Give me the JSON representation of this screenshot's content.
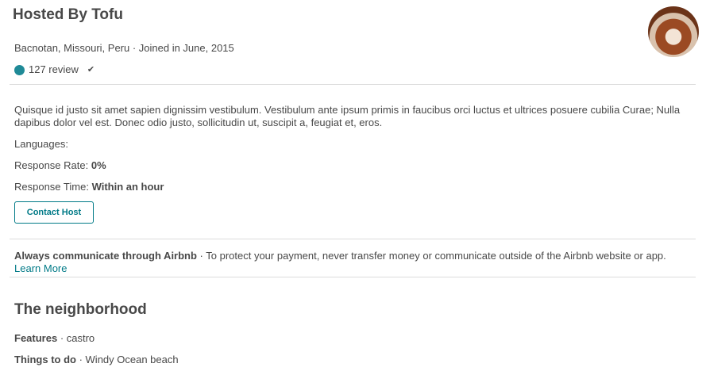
{
  "host": {
    "title": "Hosted By Tofu",
    "location": "Bacnotan, Missouri, Peru · Joined in June, 2015",
    "reviews": "127 review",
    "bio": "Quisque id justo sit amet sapien dignissim vestibulum. Vestibulum ante ipsum primis in faucibus orci luctus et ultrices posuere cubilia Curae; Nulla dapibus dolor vel est. Donec odio justo, sollicitudin ut, suscipit a, feugiat et, eros.",
    "languages_label": "Languages:",
    "response_rate_label": "Response Rate:",
    "response_rate": "0%",
    "response_time_label": "Response Time:",
    "response_time": "Within an hour",
    "contact_button": "Contact Host"
  },
  "notice": {
    "bold": "Always communicate through Airbnb",
    "text": " · To protect your payment, never transfer money or communicate outside of the Airbnb website or app. ",
    "link": "Learn More"
  },
  "neighborhood": {
    "title": "The neighborhood",
    "features_label": "Features",
    "features": " · castro",
    "todo_label": "Things to do",
    "todo": " · Windy Ocean beach"
  },
  "colors": {
    "accent": "#007a87"
  }
}
